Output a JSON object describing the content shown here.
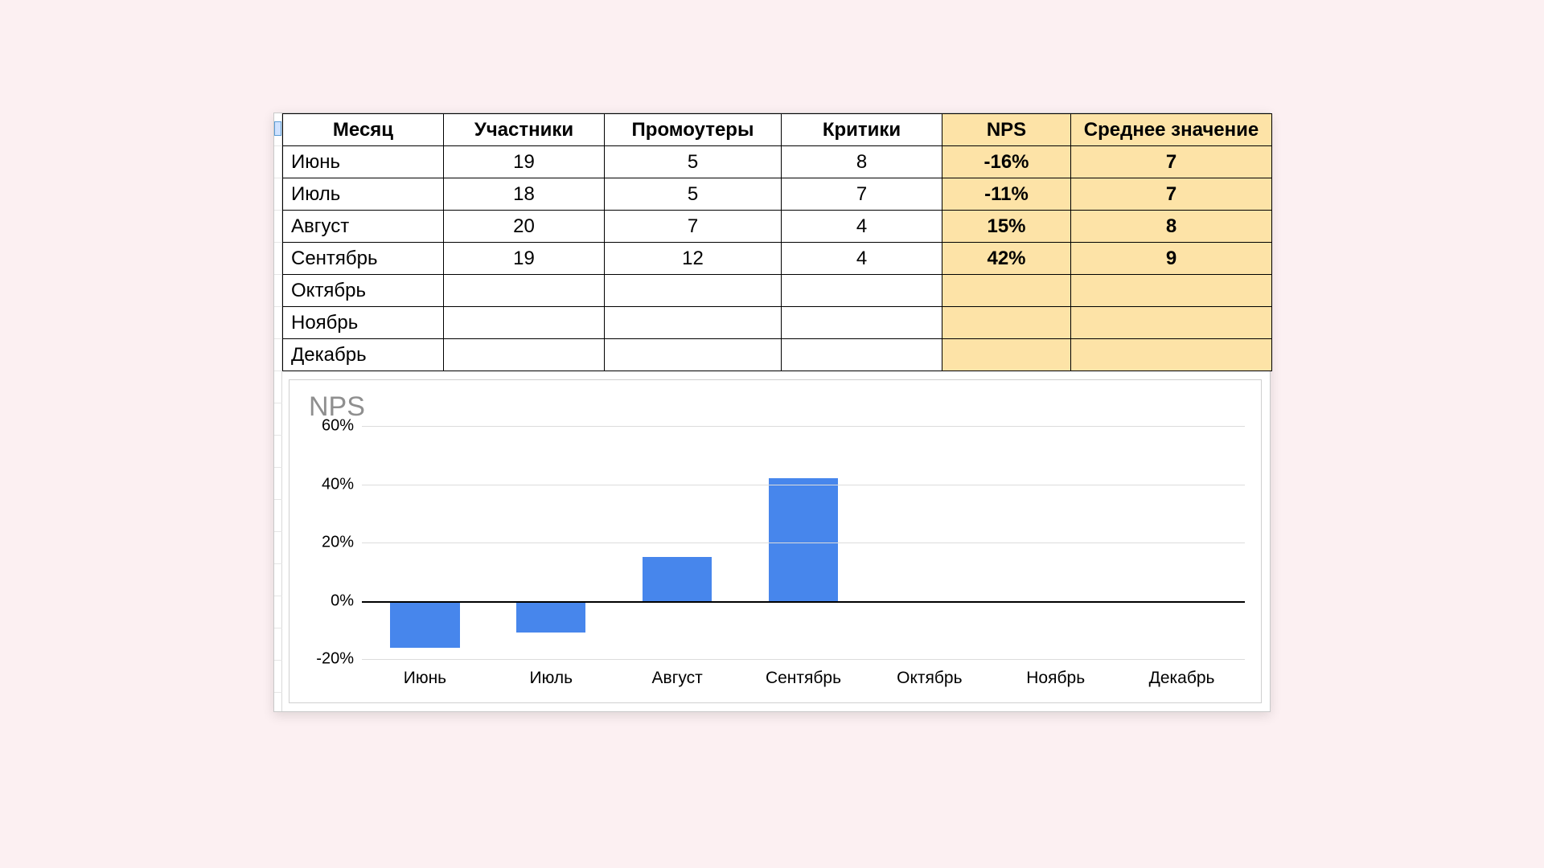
{
  "table": {
    "headers": {
      "month": "Месяц",
      "participants": "Участники",
      "promoters": "Промоутеры",
      "critics": "Критики",
      "nps": "NPS",
      "avg": "Среднее значение"
    },
    "rows": [
      {
        "month": "Июнь",
        "participants": "19",
        "promoters": "5",
        "critics": "8",
        "nps": "-16%",
        "avg": "7"
      },
      {
        "month": "Июль",
        "participants": "18",
        "promoters": "5",
        "critics": "7",
        "nps": "-11%",
        "avg": "7"
      },
      {
        "month": "Август",
        "participants": "20",
        "promoters": "7",
        "critics": "4",
        "nps": "15%",
        "avg": "8"
      },
      {
        "month": "Сентябрь",
        "participants": "19",
        "promoters": "12",
        "critics": "4",
        "nps": "42%",
        "avg": "9"
      },
      {
        "month": "Октябрь",
        "participants": "",
        "promoters": "",
        "critics": "",
        "nps": "",
        "avg": ""
      },
      {
        "month": "Ноябрь",
        "participants": "",
        "promoters": "",
        "critics": "",
        "nps": "",
        "avg": ""
      },
      {
        "month": "Декабрь",
        "participants": "",
        "promoters": "",
        "critics": "",
        "nps": "",
        "avg": ""
      }
    ]
  },
  "chart_data": {
    "type": "bar",
    "title": "NPS",
    "xlabel": "",
    "ylabel": "",
    "ylim": [
      -20,
      60
    ],
    "yticks": [
      -20,
      0,
      20,
      40,
      60
    ],
    "ytick_labels": [
      "-20%",
      "0%",
      "20%",
      "40%",
      "60%"
    ],
    "categories": [
      "Июнь",
      "Июль",
      "Август",
      "Сентябрь",
      "Октябрь",
      "Ноябрь",
      "Декабрь"
    ],
    "values": [
      -16,
      -11,
      15,
      42,
      null,
      null,
      null
    ],
    "bar_color": "#4786ec"
  }
}
